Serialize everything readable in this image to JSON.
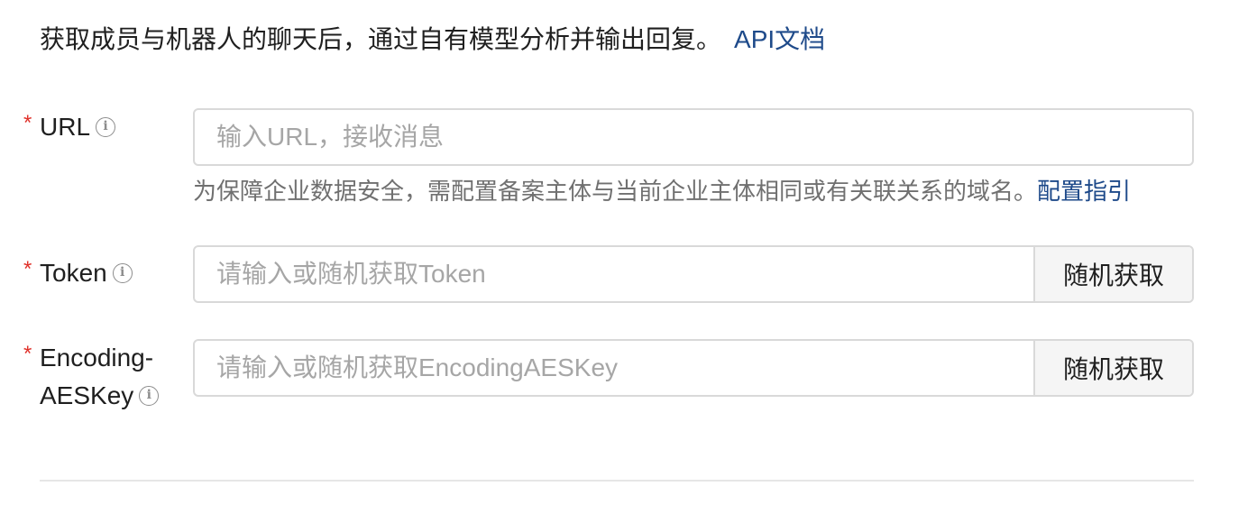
{
  "description": {
    "text": "获取成员与机器人的聊天后，通过自有模型分析并输出回复。",
    "link": "API文档"
  },
  "fields": {
    "url": {
      "required_mark": "*",
      "label": "URL",
      "info_icon": "info-circle-icon",
      "placeholder": "输入URL，接收消息",
      "value": "",
      "hint": "为保障企业数据安全，需配置备案主体与当前企业主体相同或有关联关系的域名。",
      "hint_link": "配置指引"
    },
    "token": {
      "required_mark": "*",
      "label": "Token",
      "info_icon": "info-circle-icon",
      "placeholder": "请输入或随机获取Token",
      "value": "",
      "button": "随机获取"
    },
    "aeskey": {
      "required_mark": "*",
      "label_line1": "Encoding-",
      "label_line2": "AESKey",
      "info_icon": "info-circle-icon",
      "placeholder": "请输入或随机获取EncodingAESKey",
      "value": "",
      "button": "随机获取"
    }
  },
  "colors": {
    "link": "#1e4a8a",
    "required": "#e0322b",
    "border": "#d9d9d9",
    "button_bg": "#f5f5f5"
  }
}
